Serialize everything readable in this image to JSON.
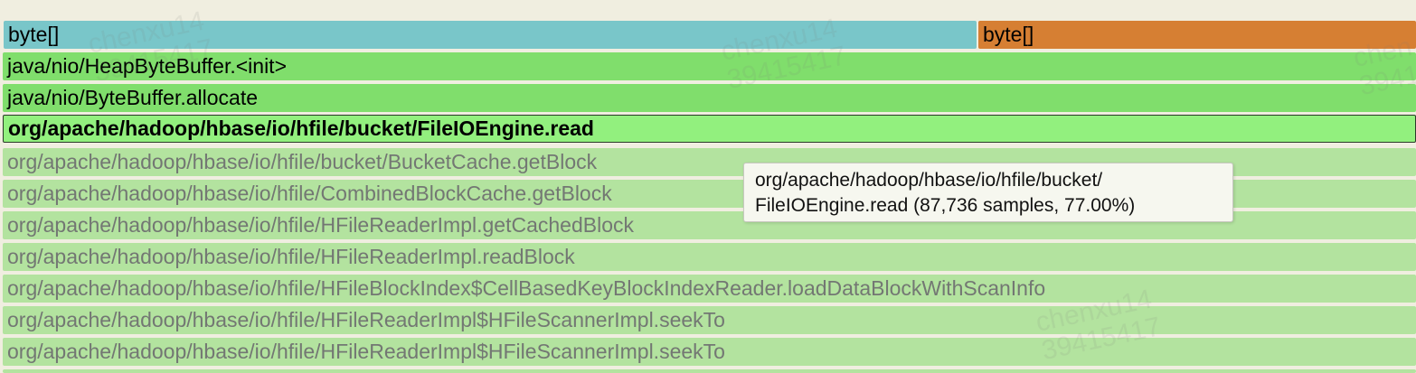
{
  "frames": [
    {
      "label": "byte[]"
    },
    {
      "label": "byte[]"
    },
    {
      "label": "java/nio/HeapByteBuffer.<init>"
    },
    {
      "label": "java/nio/ByteBuffer.allocate"
    },
    {
      "label": "org/apache/hadoop/hbase/io/hfile/bucket/FileIOEngine.read"
    },
    {
      "label": "org/apache/hadoop/hbase/io/hfile/bucket/BucketCache.getBlock"
    },
    {
      "label": "org/apache/hadoop/hbase/io/hfile/CombinedBlockCache.getBlock"
    },
    {
      "label": "org/apache/hadoop/hbase/io/hfile/HFileReaderImpl.getCachedBlock"
    },
    {
      "label": "org/apache/hadoop/hbase/io/hfile/HFileReaderImpl.readBlock"
    },
    {
      "label": "org/apache/hadoop/hbase/io/hfile/HFileBlockIndex$CellBasedKeyBlockIndexReader.loadDataBlockWithScanInfo"
    },
    {
      "label": "org/apache/hadoop/hbase/io/hfile/HFileReaderImpl$HFileScannerImpl.seekTo"
    },
    {
      "label": "org/apache/hadoop/hbase/io/hfile/HFileReaderImpl$HFileScannerImpl.seekTo"
    }
  ],
  "tooltip": {
    "line1": "org/apache/hadoop/hbase/io/hfile/bucket/",
    "line2": "FileIOEngine.read (87,736 samples, 77.00%)"
  },
  "watermarks": [
    {
      "line1": "chenxu14",
      "line2": "39415417"
    },
    {
      "line1": "chenxu14",
      "line2": "39415417"
    },
    {
      "line1": "chenxu14",
      "line2": "39415417"
    },
    {
      "line1": "chen",
      "line2": "3941"
    }
  ],
  "colors": {
    "byte_teal": "#79c6c9",
    "byte_orange": "#d67f33",
    "java_green": "#80de6c",
    "selected_green": "#92f07e",
    "dimmed_green": "#b3e39f",
    "background": "#f0eee0"
  }
}
